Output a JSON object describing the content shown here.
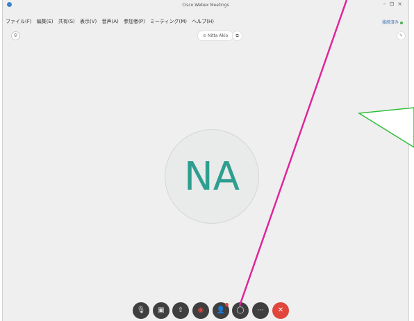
{
  "window": {
    "title": "Cisco Webex Meetings"
  },
  "menu": [
    "ファイル(F)",
    "編集(E)",
    "共有(S)",
    "表示(V)",
    "音声(A)",
    "参加者(P)",
    "ミーティング(M)",
    "ヘルプ(H)"
  ],
  "status": {
    "join_label": "接続済み"
  },
  "speaker": {
    "name": "Nitta Akio"
  },
  "participant": {
    "initials": "NA",
    "initials_color": "#2d9e8f"
  },
  "controls": [
    {
      "name": "mute-button",
      "icon": "🎙"
    },
    {
      "name": "video-button",
      "icon": "▣"
    },
    {
      "name": "share-button",
      "icon": "⇧"
    },
    {
      "name": "record-button",
      "icon": "◉"
    },
    {
      "name": "participants-button",
      "icon": "👤"
    },
    {
      "name": "chat-button",
      "icon": "◯"
    },
    {
      "name": "more-button",
      "icon": "⋯"
    },
    {
      "name": "end-meeting-button",
      "icon": "✕"
    }
  ],
  "colors": {
    "end_button": "#e0463c",
    "annotation_line": "#e0259a",
    "callout_border": "#2fbf3c"
  }
}
